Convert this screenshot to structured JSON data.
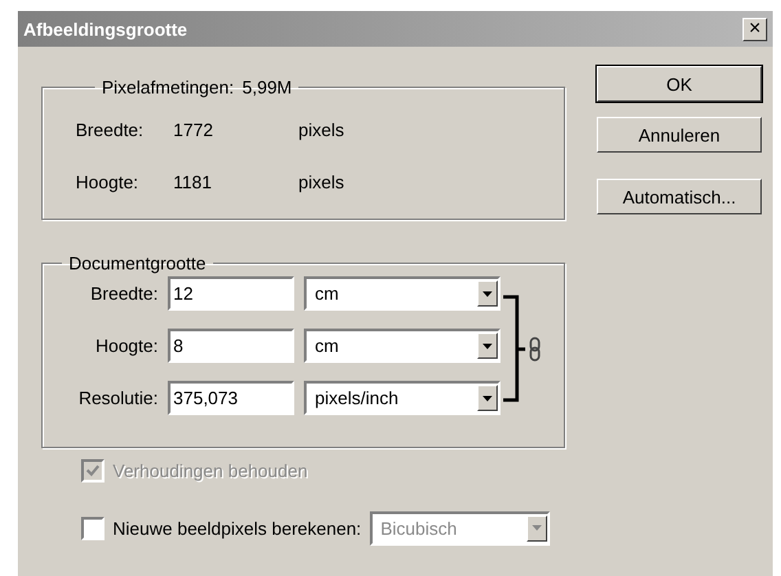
{
  "window": {
    "title": "Afbeeldingsgrootte",
    "close": "×"
  },
  "pixel_dimensions": {
    "label": "Pixelafmetingen:",
    "value": "5,99M",
    "rows": [
      {
        "label": "Breedte:",
        "value": "1772",
        "unit": "pixels"
      },
      {
        "label": "Hoogte:",
        "value": "1181",
        "unit": "pixels"
      }
    ]
  },
  "document_size": {
    "title": "Documentgrootte",
    "rows": [
      {
        "label": "Breedte:",
        "value": "12",
        "unit": "cm"
      },
      {
        "label": "Hoogte:",
        "value": "8",
        "unit": "cm"
      },
      {
        "label": "Resolutie:",
        "value": "375,073",
        "unit": "pixels/inch"
      }
    ]
  },
  "options": [
    {
      "label": "Verhoudingen behouden",
      "checked": true,
      "disabled": true
    },
    {
      "label": "Nieuwe beeldpixels berekenen:",
      "checked": false,
      "disabled": false,
      "dropdown": {
        "value": "Bicubisch",
        "disabled": true
      }
    }
  ],
  "buttons": [
    {
      "label": "OK",
      "default": true
    },
    {
      "label": "Annuleren",
      "default": false
    },
    {
      "label": "Automatisch...",
      "default": false
    }
  ]
}
